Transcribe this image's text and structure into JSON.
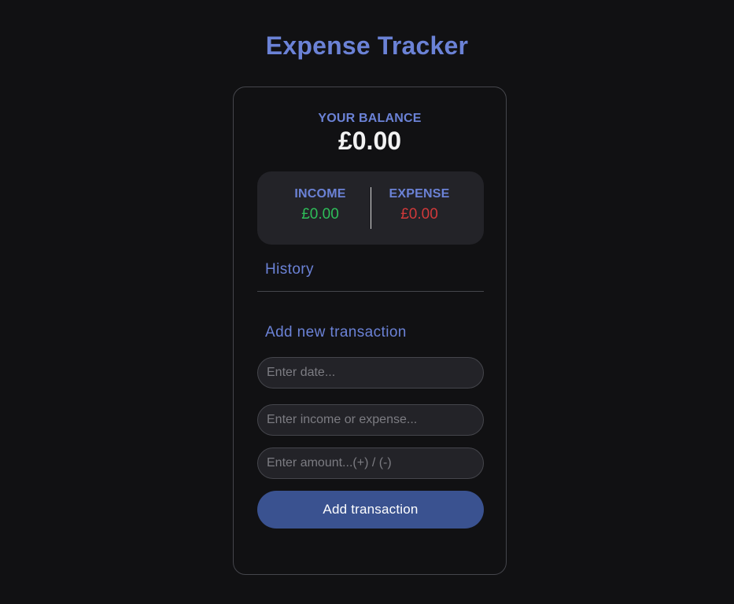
{
  "app": {
    "title": "Expense Tracker"
  },
  "balance": {
    "label": "YOUR BALANCE",
    "value": "£0.00"
  },
  "summary": {
    "income_label": "INCOME",
    "income_value": "£0.00",
    "expense_label": "EXPENSE",
    "expense_value": "£0.00"
  },
  "history": {
    "heading": "History",
    "items": []
  },
  "form": {
    "heading": "Add new transaction",
    "date_placeholder": "Enter date...",
    "text_placeholder": "Enter income or expense...",
    "amount_placeholder": "Enter amount...(+) / (-)",
    "submit_label": "Add transaction"
  },
  "colors": {
    "background": "#111113",
    "accent": "#6b82d6",
    "income": "#2ebd59",
    "expense": "#d0393a",
    "button": "#3a5290",
    "panel": "#232328"
  }
}
